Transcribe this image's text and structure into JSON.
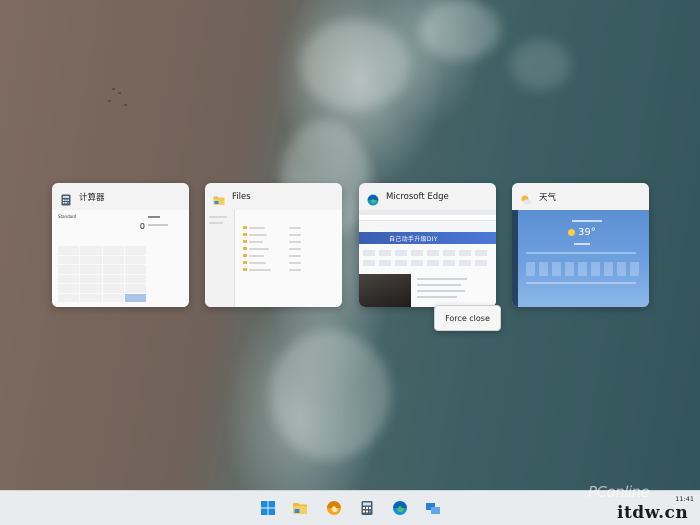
{
  "windows": [
    {
      "title": "计算器",
      "icon": "calculator-icon"
    },
    {
      "title": "Files",
      "icon": "folder-icon"
    },
    {
      "title": "Microsoft Edge",
      "icon": "edge-icon"
    },
    {
      "title": "天气",
      "icon": "weather-icon"
    }
  ],
  "calc_thumb": {
    "display": "0",
    "mode": "Standard"
  },
  "edge_thumb": {
    "banner": "自己动手升级DIY"
  },
  "weather_thumb": {
    "temp": "39°"
  },
  "context_menu": {
    "force_close": "Force close"
  },
  "taskbar": {
    "icons": [
      "windows-start-icon",
      "file-explorer-icon",
      "edge-canary-icon",
      "calculator-icon",
      "edge-icon",
      "task-view-icon"
    ],
    "time": "11:41"
  },
  "watermark": {
    "logo": "PConline",
    "url": "itdw.cn"
  },
  "colors": {
    "accent": "#0078d4",
    "card_bg": "#f3f3f3",
    "taskbar_bg": "#e9ecef"
  }
}
